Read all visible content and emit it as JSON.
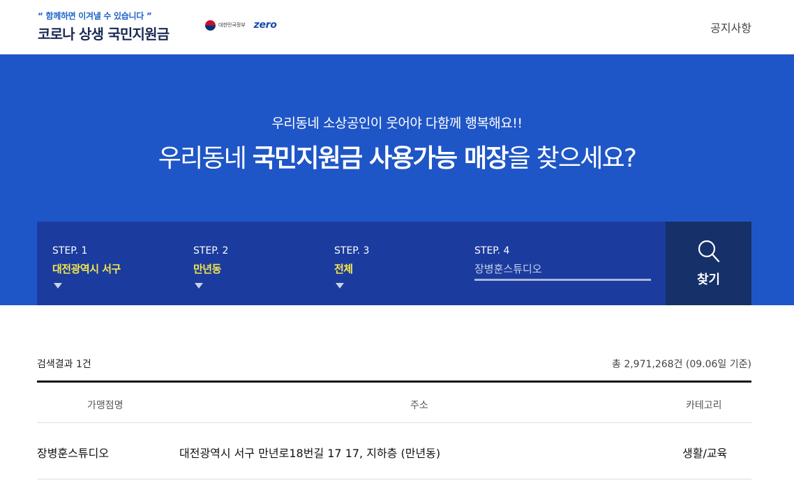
{
  "header": {
    "tagline": "“ 함께하면 이겨낼 수 있습니다 ”",
    "site_title": "코로나 상생 국민지원금",
    "gov_logo_text": "대한민국정부",
    "zero_logo_text": "zero",
    "notice_link": "공지사항"
  },
  "hero": {
    "subtitle": "우리동네 소상공인이 웃어야 다함께 행복해요!!",
    "headline_prefix": "우리동네 ",
    "headline_bold": "국민지원금 사용가능 매장",
    "headline_suffix": "을 찾으세요?"
  },
  "search": {
    "steps": [
      {
        "label": "STEP. 1",
        "value": "대전광역시 서구"
      },
      {
        "label": "STEP. 2",
        "value": "만년동"
      },
      {
        "label": "STEP. 3",
        "value": "전체"
      }
    ],
    "step4_label": "STEP. 4",
    "store_input_value": "장병훈스튜디오",
    "find_button_label": "찾기",
    "find_icon": "search-icon"
  },
  "results": {
    "count_text": "검색결과 1건",
    "total_text": "총 2,971,268건 (09.06일 기준)",
    "columns": {
      "store": "가맹점명",
      "address": "주소",
      "category": "카테고리"
    },
    "rows": [
      {
        "store": "장병훈스튜디오",
        "address": "대전광역시 서구 만년로18번길 17 17, 지하층 (만년동)",
        "category": "생활/교육"
      }
    ]
  },
  "colors": {
    "hero_bg": "#1f56c7",
    "panel_bg": "#1b3c9e",
    "button_bg": "#163069",
    "highlight": "#f5e64a"
  }
}
